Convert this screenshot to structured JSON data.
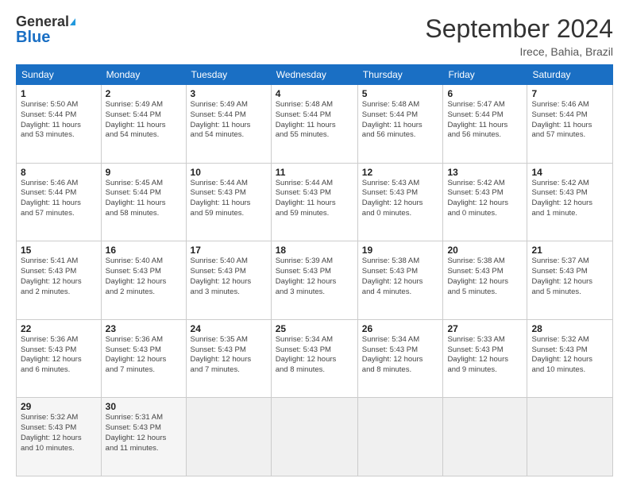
{
  "header": {
    "logo_line1": "General",
    "logo_line2": "Blue",
    "month": "September 2024",
    "location": "Irece, Bahia, Brazil"
  },
  "weekdays": [
    "Sunday",
    "Monday",
    "Tuesday",
    "Wednesday",
    "Thursday",
    "Friday",
    "Saturday"
  ],
  "weeks": [
    [
      {
        "day": "1",
        "info": "Sunrise: 5:50 AM\nSunset: 5:44 PM\nDaylight: 11 hours\nand 53 minutes."
      },
      {
        "day": "2",
        "info": "Sunrise: 5:49 AM\nSunset: 5:44 PM\nDaylight: 11 hours\nand 54 minutes."
      },
      {
        "day": "3",
        "info": "Sunrise: 5:49 AM\nSunset: 5:44 PM\nDaylight: 11 hours\nand 54 minutes."
      },
      {
        "day": "4",
        "info": "Sunrise: 5:48 AM\nSunset: 5:44 PM\nDaylight: 11 hours\nand 55 minutes."
      },
      {
        "day": "5",
        "info": "Sunrise: 5:48 AM\nSunset: 5:44 PM\nDaylight: 11 hours\nand 56 minutes."
      },
      {
        "day": "6",
        "info": "Sunrise: 5:47 AM\nSunset: 5:44 PM\nDaylight: 11 hours\nand 56 minutes."
      },
      {
        "day": "7",
        "info": "Sunrise: 5:46 AM\nSunset: 5:44 PM\nDaylight: 11 hours\nand 57 minutes."
      }
    ],
    [
      {
        "day": "8",
        "info": "Sunrise: 5:46 AM\nSunset: 5:44 PM\nDaylight: 11 hours\nand 57 minutes."
      },
      {
        "day": "9",
        "info": "Sunrise: 5:45 AM\nSunset: 5:44 PM\nDaylight: 11 hours\nand 58 minutes."
      },
      {
        "day": "10",
        "info": "Sunrise: 5:44 AM\nSunset: 5:43 PM\nDaylight: 11 hours\nand 59 minutes."
      },
      {
        "day": "11",
        "info": "Sunrise: 5:44 AM\nSunset: 5:43 PM\nDaylight: 11 hours\nand 59 minutes."
      },
      {
        "day": "12",
        "info": "Sunrise: 5:43 AM\nSunset: 5:43 PM\nDaylight: 12 hours\nand 0 minutes."
      },
      {
        "day": "13",
        "info": "Sunrise: 5:42 AM\nSunset: 5:43 PM\nDaylight: 12 hours\nand 0 minutes."
      },
      {
        "day": "14",
        "info": "Sunrise: 5:42 AM\nSunset: 5:43 PM\nDaylight: 12 hours\nand 1 minute."
      }
    ],
    [
      {
        "day": "15",
        "info": "Sunrise: 5:41 AM\nSunset: 5:43 PM\nDaylight: 12 hours\nand 2 minutes."
      },
      {
        "day": "16",
        "info": "Sunrise: 5:40 AM\nSunset: 5:43 PM\nDaylight: 12 hours\nand 2 minutes."
      },
      {
        "day": "17",
        "info": "Sunrise: 5:40 AM\nSunset: 5:43 PM\nDaylight: 12 hours\nand 3 minutes."
      },
      {
        "day": "18",
        "info": "Sunrise: 5:39 AM\nSunset: 5:43 PM\nDaylight: 12 hours\nand 3 minutes."
      },
      {
        "day": "19",
        "info": "Sunrise: 5:38 AM\nSunset: 5:43 PM\nDaylight: 12 hours\nand 4 minutes."
      },
      {
        "day": "20",
        "info": "Sunrise: 5:38 AM\nSunset: 5:43 PM\nDaylight: 12 hours\nand 5 minutes."
      },
      {
        "day": "21",
        "info": "Sunrise: 5:37 AM\nSunset: 5:43 PM\nDaylight: 12 hours\nand 5 minutes."
      }
    ],
    [
      {
        "day": "22",
        "info": "Sunrise: 5:36 AM\nSunset: 5:43 PM\nDaylight: 12 hours\nand 6 minutes."
      },
      {
        "day": "23",
        "info": "Sunrise: 5:36 AM\nSunset: 5:43 PM\nDaylight: 12 hours\nand 7 minutes."
      },
      {
        "day": "24",
        "info": "Sunrise: 5:35 AM\nSunset: 5:43 PM\nDaylight: 12 hours\nand 7 minutes."
      },
      {
        "day": "25",
        "info": "Sunrise: 5:34 AM\nSunset: 5:43 PM\nDaylight: 12 hours\nand 8 minutes."
      },
      {
        "day": "26",
        "info": "Sunrise: 5:34 AM\nSunset: 5:43 PM\nDaylight: 12 hours\nand 8 minutes."
      },
      {
        "day": "27",
        "info": "Sunrise: 5:33 AM\nSunset: 5:43 PM\nDaylight: 12 hours\nand 9 minutes."
      },
      {
        "day": "28",
        "info": "Sunrise: 5:32 AM\nSunset: 5:43 PM\nDaylight: 12 hours\nand 10 minutes."
      }
    ],
    [
      {
        "day": "29",
        "info": "Sunrise: 5:32 AM\nSunset: 5:43 PM\nDaylight: 12 hours\nand 10 minutes."
      },
      {
        "day": "30",
        "info": "Sunrise: 5:31 AM\nSunset: 5:43 PM\nDaylight: 12 hours\nand 11 minutes."
      },
      {
        "day": "",
        "info": ""
      },
      {
        "day": "",
        "info": ""
      },
      {
        "day": "",
        "info": ""
      },
      {
        "day": "",
        "info": ""
      },
      {
        "day": "",
        "info": ""
      }
    ]
  ]
}
